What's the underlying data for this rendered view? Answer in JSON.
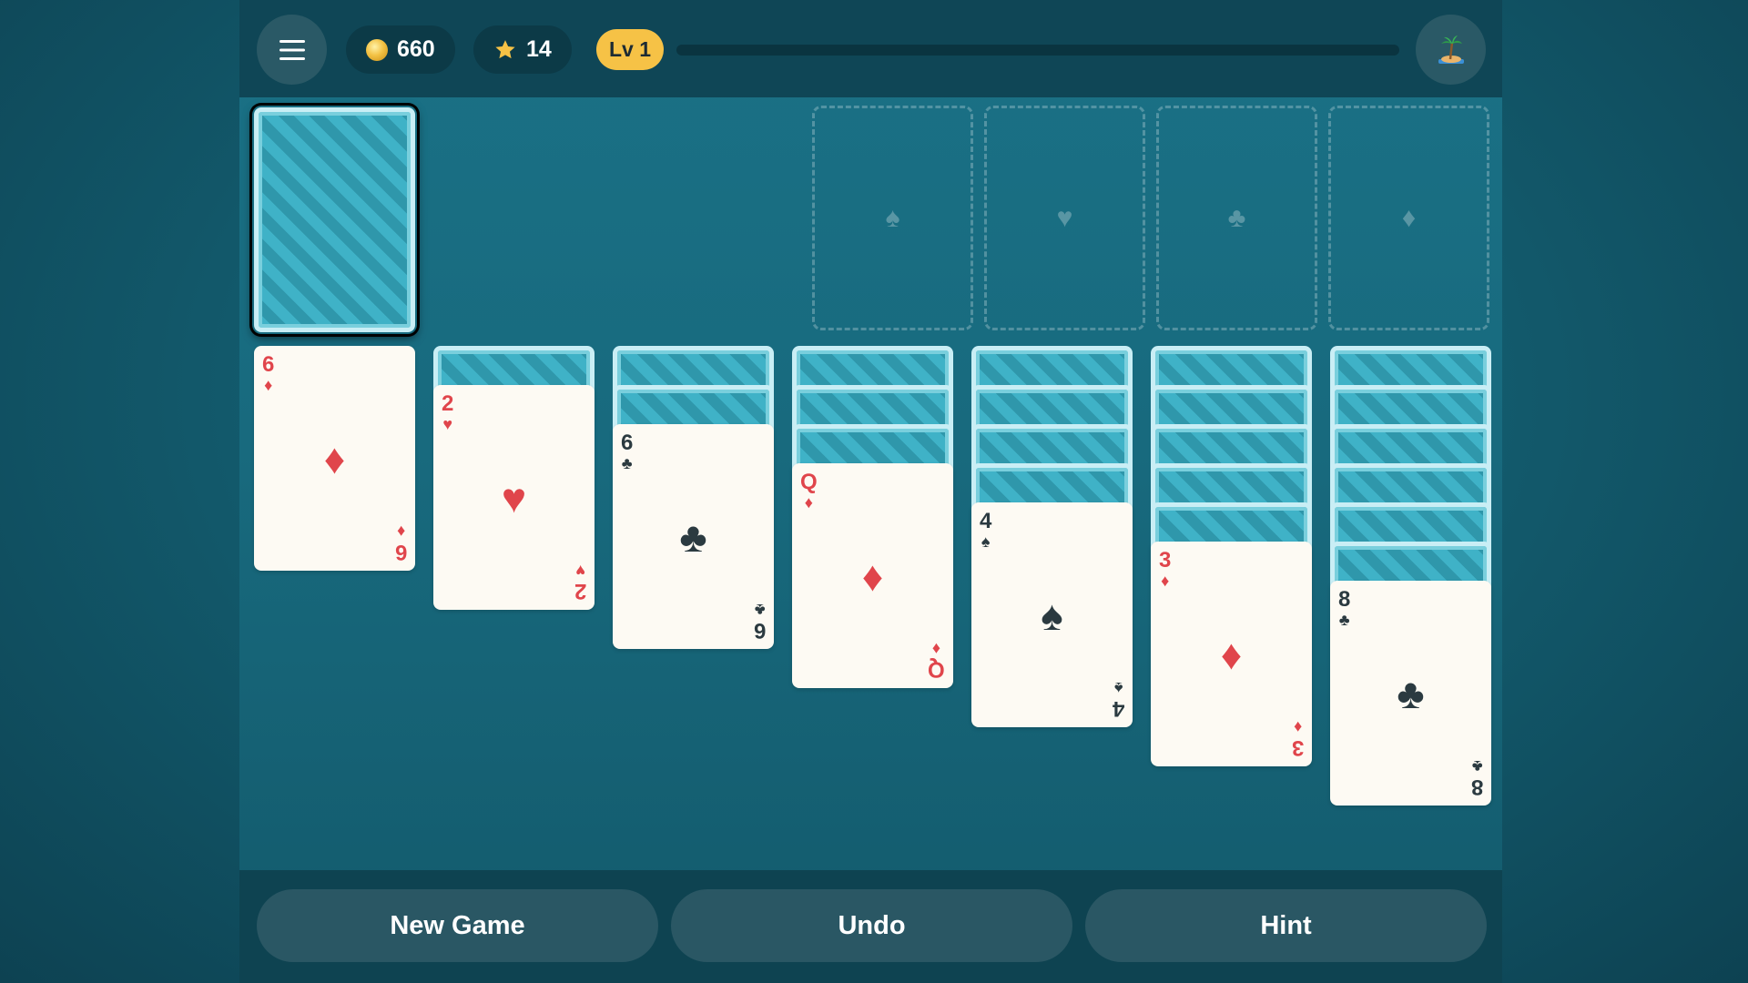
{
  "topbar": {
    "coins": "660",
    "stars": "14",
    "level": "Lv 1",
    "xp_progress": 0
  },
  "foundations": [
    {
      "suit": "♠",
      "name": "spades"
    },
    {
      "suit": "♥",
      "name": "hearts"
    },
    {
      "suit": "♣",
      "name": "clubs"
    },
    {
      "suit": "♦",
      "name": "diamonds"
    }
  ],
  "tableau": [
    {
      "face_down": 0,
      "rank": "6",
      "suit": "♦",
      "color": "red"
    },
    {
      "face_down": 1,
      "rank": "2",
      "suit": "♥",
      "color": "red"
    },
    {
      "face_down": 2,
      "rank": "6",
      "suit": "♣",
      "color": "black"
    },
    {
      "face_down": 3,
      "rank": "Q",
      "suit": "♦",
      "color": "red"
    },
    {
      "face_down": 4,
      "rank": "4",
      "suit": "♠",
      "color": "black"
    },
    {
      "face_down": 5,
      "rank": "3",
      "suit": "♦",
      "color": "red"
    },
    {
      "face_down": 6,
      "rank": "8",
      "suit": "♣",
      "color": "black"
    }
  ],
  "actions": {
    "new_game": "New Game",
    "undo": "Undo",
    "hint": "Hint"
  },
  "colors": {
    "accent_gold": "#f6c246",
    "card_red": "#e0454b",
    "card_black": "#2b3a40",
    "table_teal": "#1a7186"
  }
}
